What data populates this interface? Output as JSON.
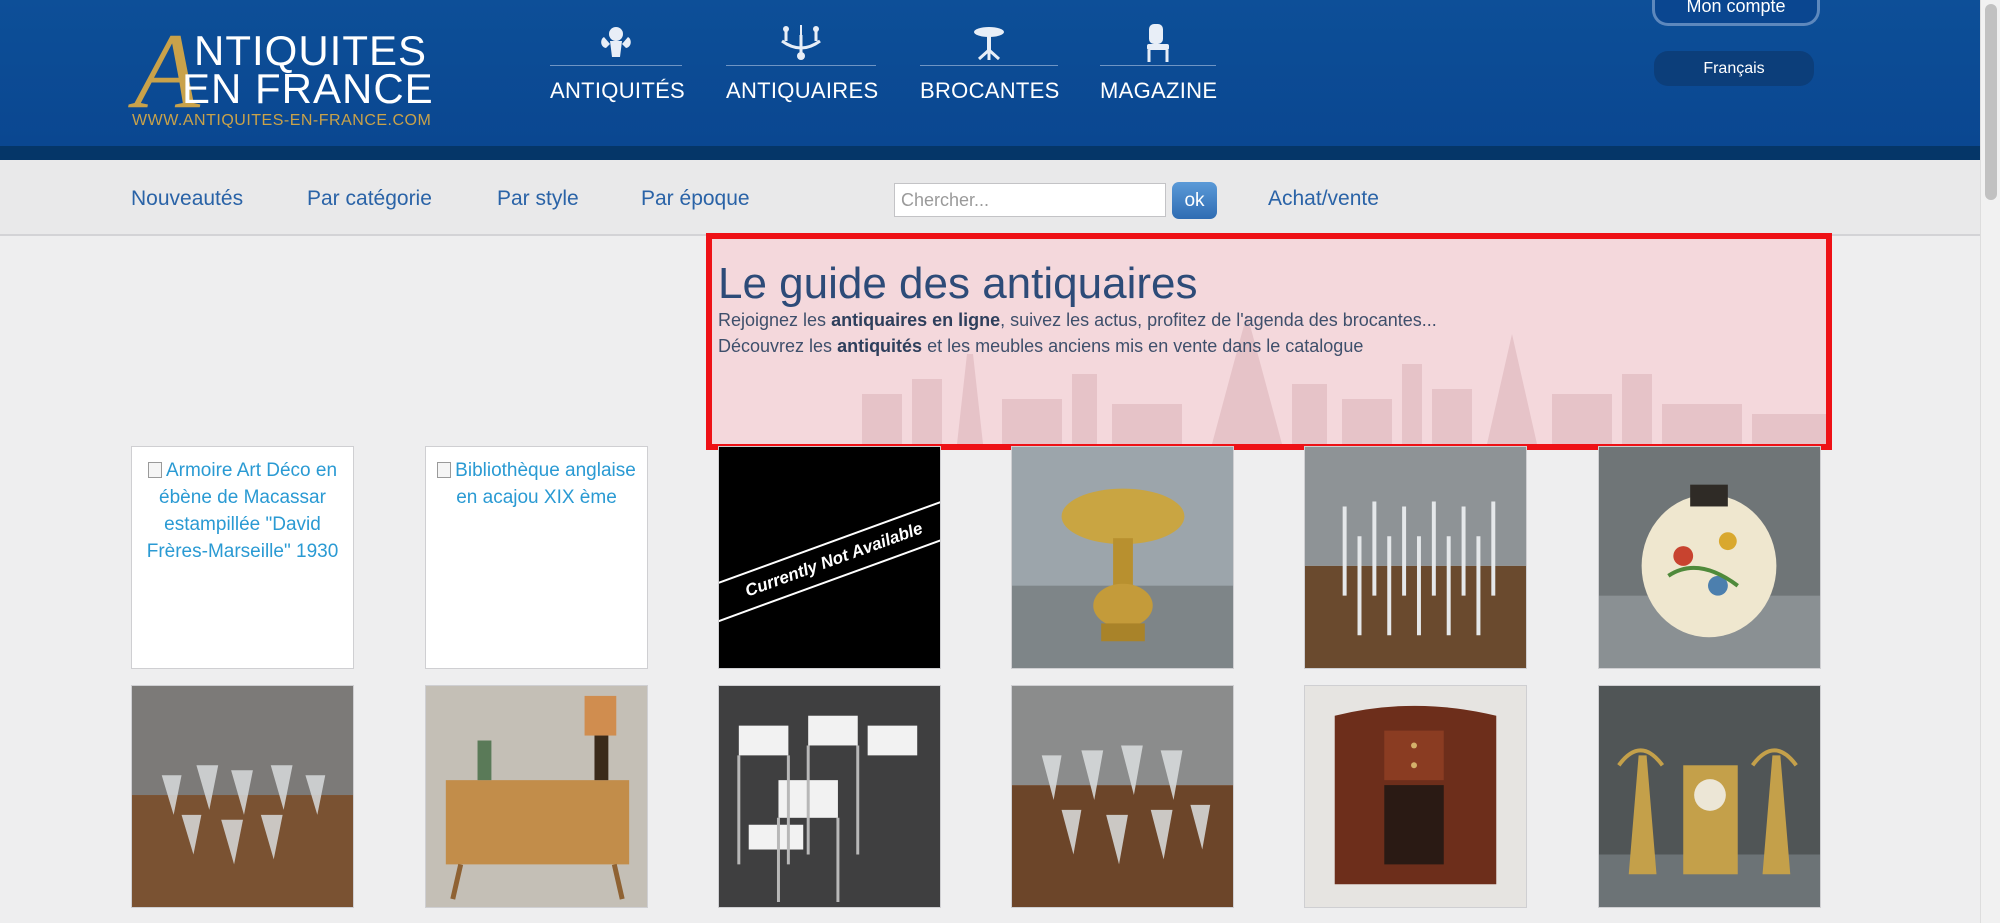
{
  "logo": {
    "initial": "A",
    "line1": "NTIQUITES",
    "line2": "EN FRANCE",
    "url": "WWW.ANTIQUITES-EN-FRANCE.COM"
  },
  "main_nav": [
    {
      "label": "ANTIQUITÉS",
      "icon": "cherub-icon"
    },
    {
      "label": "ANTIQUAIRES",
      "icon": "chandelier-icon"
    },
    {
      "label": "BROCANTES",
      "icon": "table-icon"
    },
    {
      "label": "MAGAZINE",
      "icon": "chair-icon"
    }
  ],
  "account": {
    "label": "Mon compte"
  },
  "language": {
    "label": "Français"
  },
  "sub_nav": {
    "items": [
      "Nouveautés",
      "Par catégorie",
      "Par style",
      "Par époque"
    ],
    "search_placeholder": "Chercher...",
    "search_button": "ok",
    "buy_sell": "Achat/vente"
  },
  "guide": {
    "title": "Le guide des antiquaires",
    "line1_pre": "Rejoignez les ",
    "line1_bold": "antiquaires en ligne",
    "line1_post": ", suivez les actus, profitez de l'agenda des brocantes...",
    "line2_pre": "Découvrez les ",
    "line2_bold": "antiquités",
    "line2_post": " et les meubles anciens mis en vente dans le catalogue"
  },
  "products": [
    {
      "type": "broken",
      "alt": "Armoire Art Déco en ébène de Macassar estampillée \"David Frères-Marseille\" 1930"
    },
    {
      "type": "broken",
      "alt": "Bibliothèque anglaise en acajou XIX ème"
    },
    {
      "type": "unavailable",
      "text": "Currently Not Available"
    },
    {
      "type": "photo",
      "subject": "brass-lamp"
    },
    {
      "type": "photo",
      "subject": "champagne-flutes"
    },
    {
      "type": "photo",
      "subject": "floral-vase"
    },
    {
      "type": "photo",
      "subject": "crystal-glasses"
    },
    {
      "type": "photo",
      "subject": "sideboard-with-lamp"
    },
    {
      "type": "photo",
      "subject": "white-armchairs"
    },
    {
      "type": "photo",
      "subject": "wine-glasses"
    },
    {
      "type": "photo",
      "subject": "art-deco-cabinet"
    },
    {
      "type": "photo",
      "subject": "gilt-clock-set"
    }
  ]
}
